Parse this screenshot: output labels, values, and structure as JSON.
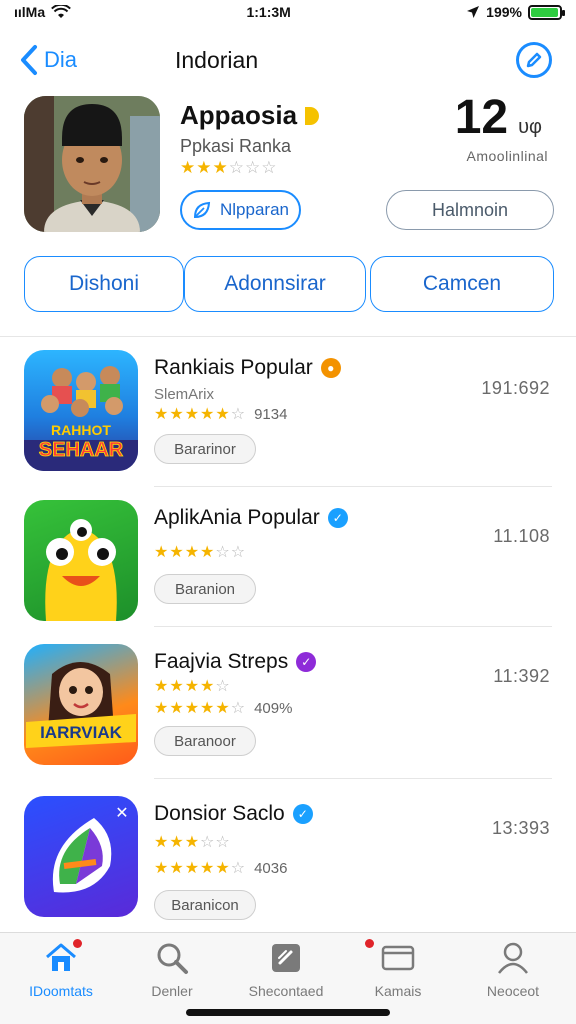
{
  "status_bar": {
    "carrier": "ıılMa",
    "time": "1:1:3M",
    "battery_percent": "199%",
    "battery_level": 0.95
  },
  "nav": {
    "back_label": "Dia",
    "title": "Indorian"
  },
  "hero": {
    "title": "Appaosia",
    "subtitle": "Ppkasi Ranka",
    "rating": 3.5,
    "count_value": "12",
    "count_unit": "υφ",
    "count_label": "Amoolinlinal",
    "primary_button": "Nlpparan",
    "secondary_button": "Halmnoin"
  },
  "segments": [
    "Dishoni",
    "Adonnsirar",
    "Camcen"
  ],
  "apps": [
    {
      "title": "Rankiais Popular",
      "subtitle": "SlemArix",
      "rating_text": "9134",
      "button": "Bararinor",
      "value": "191:692",
      "badge_color": "#f39200",
      "icon_text": "SEHAAR",
      "icon_text_top": "RAHHOT"
    },
    {
      "title": "AplikAnia Popular",
      "subtitle": "",
      "rating_text": "",
      "button": "Baranion",
      "value": "11.108",
      "badge_color": "#1aa0ff",
      "icon_text": ""
    },
    {
      "title": "Faajvia Streps",
      "subtitle": "",
      "rating_text": "409%",
      "button": "Baranoor",
      "value": "11:392",
      "badge_color": "#8e2bd8",
      "icon_text": "IARRVIAK"
    },
    {
      "title": "Donsior Saclo",
      "subtitle": "",
      "rating_text": "4036",
      "button": "Baranicon",
      "value": "13:393",
      "badge_color": "#1aa0ff",
      "icon_text": ""
    }
  ],
  "tabs": [
    {
      "label": "IDoomtats",
      "icon": "home-icon",
      "active": true
    },
    {
      "label": "Denler",
      "icon": "search-icon",
      "active": false
    },
    {
      "label": "Shecontaed",
      "icon": "bookmark-icon",
      "active": false
    },
    {
      "label": "Kamais",
      "icon": "card-icon",
      "active": false
    },
    {
      "label": "Neoceot",
      "icon": "profile-icon",
      "active": false
    }
  ],
  "colors": {
    "accent": "#1a8cff",
    "star": "#f5b400",
    "notification": "#e0242a"
  }
}
